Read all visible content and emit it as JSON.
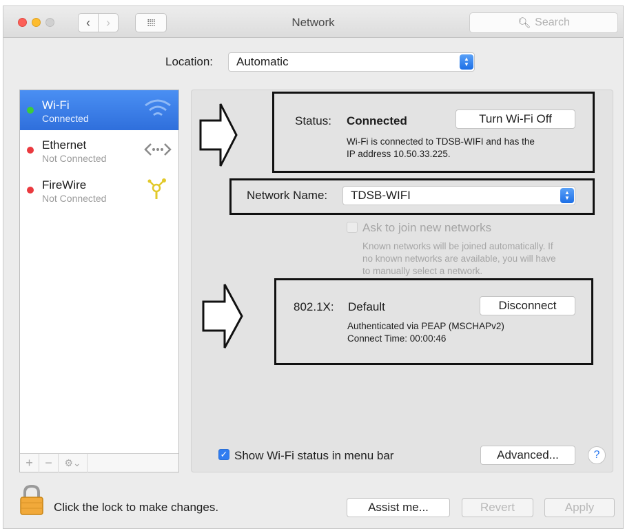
{
  "window": {
    "title": "Network",
    "search_placeholder": "Search"
  },
  "toolbar": {
    "back_icon": "chevron-left-icon",
    "forward_icon": "chevron-right-icon",
    "show_all_icon": "grid-icon"
  },
  "location": {
    "label": "Location:",
    "value": "Automatic"
  },
  "sidebar": {
    "items": [
      {
        "name": "Wi-Fi",
        "status": "Connected",
        "status_color": "#3ccc3a",
        "icon": "wifi-icon",
        "selected": true
      },
      {
        "name": "Ethernet",
        "status": "Not Connected",
        "status_color": "#ea3a3f",
        "icon": "ethernet-icon",
        "selected": false
      },
      {
        "name": "FireWire",
        "status": "Not Connected",
        "status_color": "#ea3a3f",
        "icon": "firewire-icon",
        "selected": false
      }
    ],
    "footer": {
      "add": "+",
      "remove": "−",
      "gear": "⚙⌄"
    }
  },
  "status": {
    "label": "Status:",
    "value": "Connected",
    "button": "Turn Wi-Fi Off",
    "description_line1": "Wi-Fi is connected to TDSB-WIFI and has the",
    "description_line2": "IP address 10.50.33.225."
  },
  "network_name": {
    "label": "Network Name:",
    "value": "TDSB-WIFI"
  },
  "ask_to_join": {
    "label": "Ask to join new networks",
    "checked": false,
    "help_line1": "Known networks will be joined automatically. If",
    "help_line2": "no known networks are available, you will have",
    "help_line3": "to manually select a network."
  },
  "dot1x": {
    "label": "802.1X:",
    "value": "Default",
    "button": "Disconnect",
    "line1": "Authenticated via PEAP (MSCHAPv2)",
    "line2": "Connect Time: 00:00:46"
  },
  "footer": {
    "show_wifi_status": "Show Wi-Fi status in menu bar",
    "show_wifi_checked": true,
    "advanced_button": "Advanced...",
    "help_button": "?",
    "lock_text": "Click the lock to make changes.",
    "assist_button": "Assist me...",
    "revert_button": "Revert",
    "apply_button": "Apply"
  },
  "colors": {
    "accent": "#2f7cf0",
    "selection": "#3b7fe8"
  }
}
